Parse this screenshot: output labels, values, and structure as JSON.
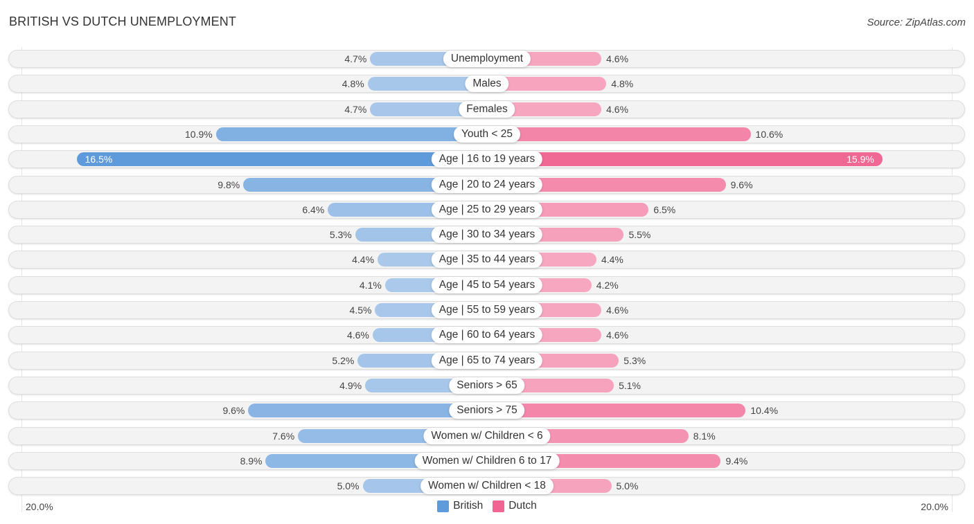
{
  "header": {
    "title": "BRITISH VS DUTCH UNEMPLOYMENT",
    "source": "Source: ZipAtlas.com"
  },
  "colors": {
    "british_dark": "#5f9bdb",
    "british_light": "#abc9eb",
    "dutch_dark": "#f06592",
    "dutch_light": "#f7a9c1",
    "row_background": "#f3f3f3"
  },
  "chart_data": {
    "type": "bar",
    "orientation": "horizontal-diverging",
    "title": "BRITISH VS DUTCH UNEMPLOYMENT",
    "xlabel": "",
    "ylabel": "",
    "xlim": [
      -20,
      20
    ],
    "axis_labels": {
      "left": "20.0%",
      "right": "20.0%"
    },
    "legend": {
      "position": "bottom-center",
      "entries": [
        "British",
        "Dutch"
      ]
    },
    "grid": false,
    "categories": [
      "Unemployment",
      "Males",
      "Females",
      "Youth < 25",
      "Age | 16 to 19 years",
      "Age | 20 to 24 years",
      "Age | 25 to 29 years",
      "Age | 30 to 34 years",
      "Age | 35 to 44 years",
      "Age | 45 to 54 years",
      "Age | 55 to 59 years",
      "Age | 60 to 64 years",
      "Age | 65 to 74 years",
      "Seniors > 65",
      "Seniors > 75",
      "Women w/ Children < 6",
      "Women w/ Children 6 to 17",
      "Women w/ Children < 18"
    ],
    "series": [
      {
        "name": "British",
        "side": "left",
        "values": [
          4.7,
          4.8,
          4.7,
          10.9,
          16.5,
          9.8,
          6.4,
          5.3,
          4.4,
          4.1,
          4.5,
          4.6,
          5.2,
          4.9,
          9.6,
          7.6,
          8.9,
          5.0
        ],
        "labels": [
          "4.7%",
          "4.8%",
          "4.7%",
          "10.9%",
          "16.5%",
          "9.8%",
          "6.4%",
          "5.3%",
          "4.4%",
          "4.1%",
          "4.5%",
          "4.6%",
          "5.2%",
          "4.9%",
          "9.6%",
          "7.6%",
          "8.9%",
          "5.0%"
        ]
      },
      {
        "name": "Dutch",
        "side": "right",
        "values": [
          4.6,
          4.8,
          4.6,
          10.6,
          15.9,
          9.6,
          6.5,
          5.5,
          4.4,
          4.2,
          4.6,
          4.6,
          5.3,
          5.1,
          10.4,
          8.1,
          9.4,
          5.0
        ],
        "labels": [
          "4.6%",
          "4.8%",
          "4.6%",
          "10.6%",
          "15.9%",
          "9.6%",
          "6.5%",
          "5.5%",
          "4.4%",
          "4.2%",
          "4.6%",
          "4.6%",
          "5.3%",
          "5.1%",
          "10.4%",
          "8.1%",
          "9.4%",
          "5.0%"
        ]
      }
    ]
  }
}
